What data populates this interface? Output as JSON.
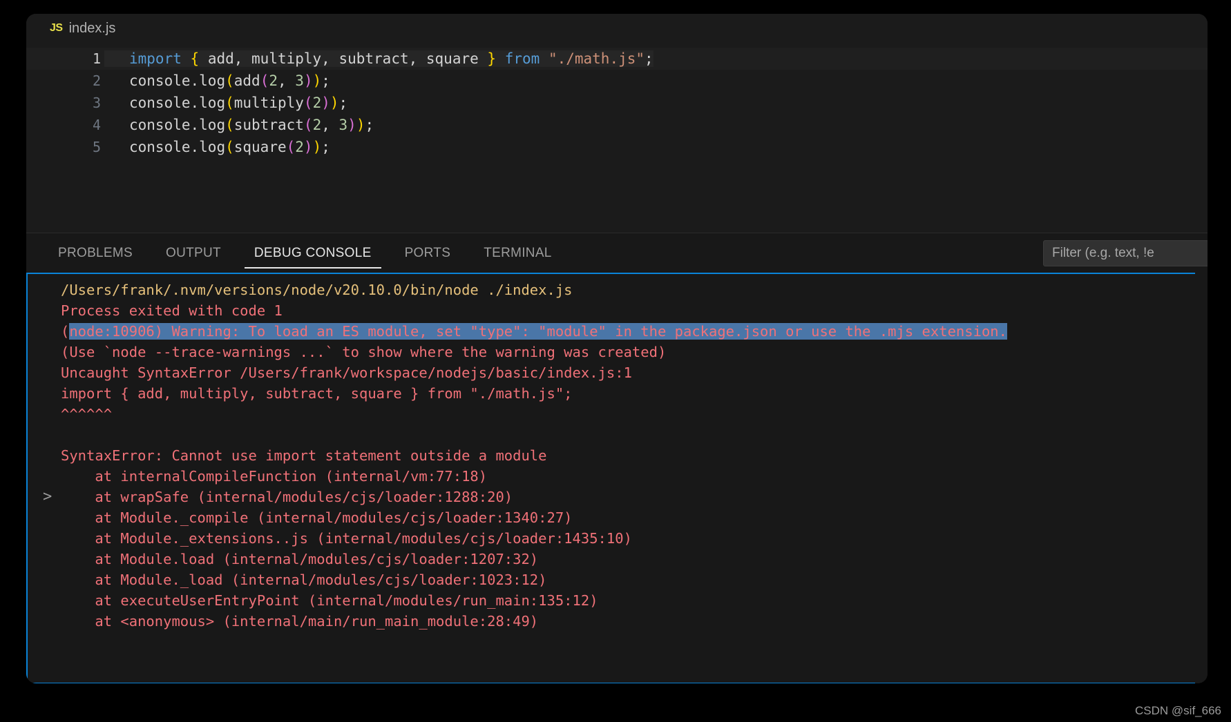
{
  "colors": {
    "background": "#000000",
    "editor_bg": "#1b1b1b",
    "panel_bg": "#181818",
    "focus_border": "#0a84d8",
    "selection": "#4a76a8",
    "error_text": "#f07178",
    "warning_text": "#e5c07b",
    "js_icon": "#e8e04a",
    "keyword": "#569cd6",
    "string": "#ce9178",
    "number": "#b5cea8",
    "function": "#dcdcaa",
    "brace_yellow": "#ffd700",
    "paren_magenta": "#da70d6"
  },
  "editor": {
    "breadcrumb": {
      "icon": "js-file-icon",
      "icon_label": "JS",
      "filename": "index.js"
    },
    "lines": [
      {
        "number": "1",
        "active": true,
        "tokens": [
          {
            "t": "import",
            "c": "tk-kw"
          },
          {
            "t": " ",
            "c": "tk-plain"
          },
          {
            "t": "{",
            "c": "tk-brace"
          },
          {
            "t": " add, multiply, subtract, square ",
            "c": "tk-plain"
          },
          {
            "t": "}",
            "c": "tk-brace"
          },
          {
            "t": " ",
            "c": "tk-plain"
          },
          {
            "t": "from",
            "c": "tk-kw"
          },
          {
            "t": " ",
            "c": "tk-plain"
          },
          {
            "t": "\"./math.js\"",
            "c": "tk-str"
          },
          {
            "t": ";",
            "c": "tk-punct"
          }
        ]
      },
      {
        "number": "2",
        "active": false,
        "tokens": [
          {
            "t": "console.",
            "c": "tk-plain"
          },
          {
            "t": "log",
            "c": "tk-plain"
          },
          {
            "t": "(",
            "c": "tk-paren1"
          },
          {
            "t": "add",
            "c": "tk-plain"
          },
          {
            "t": "(",
            "c": "tk-paren2"
          },
          {
            "t": "2",
            "c": "tk-num"
          },
          {
            "t": ", ",
            "c": "tk-plain"
          },
          {
            "t": "3",
            "c": "tk-num"
          },
          {
            "t": ")",
            "c": "tk-paren2"
          },
          {
            "t": ")",
            "c": "tk-paren1"
          },
          {
            "t": ";",
            "c": "tk-punct"
          }
        ]
      },
      {
        "number": "3",
        "active": false,
        "tokens": [
          {
            "t": "console.",
            "c": "tk-plain"
          },
          {
            "t": "log",
            "c": "tk-plain"
          },
          {
            "t": "(",
            "c": "tk-paren1"
          },
          {
            "t": "multiply",
            "c": "tk-plain"
          },
          {
            "t": "(",
            "c": "tk-paren2"
          },
          {
            "t": "2",
            "c": "tk-num"
          },
          {
            "t": ")",
            "c": "tk-paren2"
          },
          {
            "t": ")",
            "c": "tk-paren1"
          },
          {
            "t": ";",
            "c": "tk-punct"
          }
        ]
      },
      {
        "number": "4",
        "active": false,
        "tokens": [
          {
            "t": "console.",
            "c": "tk-plain"
          },
          {
            "t": "log",
            "c": "tk-plain"
          },
          {
            "t": "(",
            "c": "tk-paren1"
          },
          {
            "t": "subtract",
            "c": "tk-plain"
          },
          {
            "t": "(",
            "c": "tk-paren2"
          },
          {
            "t": "2",
            "c": "tk-num"
          },
          {
            "t": ", ",
            "c": "tk-plain"
          },
          {
            "t": "3",
            "c": "tk-num"
          },
          {
            "t": ")",
            "c": "tk-paren2"
          },
          {
            "t": ")",
            "c": "tk-paren1"
          },
          {
            "t": ";",
            "c": "tk-punct"
          }
        ]
      },
      {
        "number": "5",
        "active": false,
        "tokens": [
          {
            "t": "console.",
            "c": "tk-plain"
          },
          {
            "t": "log",
            "c": "tk-plain"
          },
          {
            "t": "(",
            "c": "tk-paren1"
          },
          {
            "t": "square",
            "c": "tk-plain"
          },
          {
            "t": "(",
            "c": "tk-paren2"
          },
          {
            "t": "2",
            "c": "tk-num"
          },
          {
            "t": ")",
            "c": "tk-paren2"
          },
          {
            "t": ")",
            "c": "tk-paren1"
          },
          {
            "t": ";",
            "c": "tk-punct"
          }
        ]
      }
    ]
  },
  "panel": {
    "tabs": [
      {
        "label": "PROBLEMS",
        "active": false
      },
      {
        "label": "OUTPUT",
        "active": false
      },
      {
        "label": "DEBUG CONSOLE",
        "active": true
      },
      {
        "label": "PORTS",
        "active": false
      },
      {
        "label": "TERMINAL",
        "active": false
      }
    ],
    "filter": {
      "placeholder": "Filter (e.g. text, !e",
      "value": ""
    }
  },
  "console_output": {
    "prompt_symbol": ">",
    "lines": [
      {
        "id": "node-command",
        "color": "c-yellow",
        "text": "/Users/frank/.nvm/versions/node/v20.10.0/bin/node ./index.js",
        "highlight": false
      },
      {
        "id": "process-exit",
        "color": "c-red",
        "text": "Process exited with code 1",
        "highlight": false
      },
      {
        "id": "es-module-warning",
        "color": "c-red",
        "prefix": "(",
        "text": "node:10906) Warning: To load an ES module, set \"type\": \"module\" in the package.json or use the .mjs extension.",
        "highlight": true
      },
      {
        "id": "trace-warnings-hint",
        "color": "c-red",
        "text": "(Use `node --trace-warnings ...` to show where the warning was created)",
        "highlight": false
      },
      {
        "id": "uncaught-syntaxerror",
        "color": "c-red",
        "text": "Uncaught SyntaxError /Users/frank/workspace/nodejs/basic/index.js:1",
        "highlight": false
      },
      {
        "id": "offending-source",
        "color": "c-red",
        "text": "import { add, multiply, subtract, square } from \"./math.js\";",
        "highlight": false
      },
      {
        "id": "caret-marker",
        "color": "c-red",
        "text": "^^^^^^",
        "highlight": false
      },
      {
        "id": "blank-1",
        "color": "c-red",
        "text": " ",
        "highlight": false
      },
      {
        "id": "syntaxerror-message",
        "color": "c-red",
        "text": "SyntaxError: Cannot use import statement outside a module",
        "highlight": false
      },
      {
        "id": "stack-internalCompileFunction",
        "color": "c-red",
        "text": "    at internalCompileFunction (internal/vm:77:18)",
        "highlight": false
      },
      {
        "id": "stack-wrapSafe",
        "color": "c-red",
        "text": "    at wrapSafe (internal/modules/cjs/loader:1288:20)",
        "highlight": false,
        "chevron": true
      },
      {
        "id": "stack-Module-compile",
        "color": "c-red",
        "text": "    at Module._compile (internal/modules/cjs/loader:1340:27)",
        "highlight": false
      },
      {
        "id": "stack-Module-extensions-js",
        "color": "c-red",
        "text": "    at Module._extensions..js (internal/modules/cjs/loader:1435:10)",
        "highlight": false
      },
      {
        "id": "stack-Module-load",
        "color": "c-red",
        "text": "    at Module.load (internal/modules/cjs/loader:1207:32)",
        "highlight": false
      },
      {
        "id": "stack-Module-_load",
        "color": "c-red",
        "text": "    at Module._load (internal/modules/cjs/loader:1023:12)",
        "highlight": false
      },
      {
        "id": "stack-executeUserEntryPoint",
        "color": "c-red",
        "text": "    at executeUserEntryPoint (internal/modules/run_main:135:12)",
        "highlight": false
      },
      {
        "id": "stack-anonymous",
        "color": "c-red",
        "text": "    at <anonymous> (internal/main/run_main_module:28:49)",
        "highlight": false
      }
    ]
  },
  "watermark": {
    "text": "CSDN @sif_666"
  }
}
